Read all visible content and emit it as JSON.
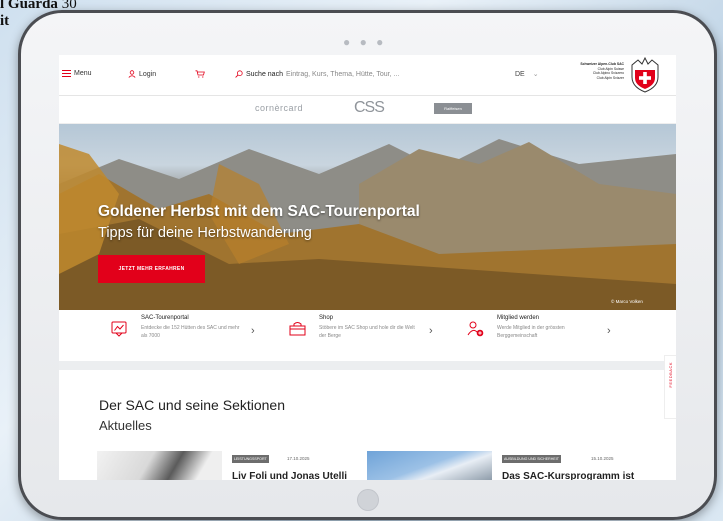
{
  "background": {
    "fragment_title": "l Guarda",
    "fragment_number": "30",
    "fragment_second_line": "it"
  },
  "header": {
    "menu_label": "Menu",
    "login_label": "Login",
    "search_label": "Suche nach",
    "search_placeholder": "Eintrag, Kurs, Thema, Hütte, Tour, ...",
    "language": "DE",
    "club_name": "Schweizer Alpen-Club SAC",
    "club_lines": [
      "Club Alpin Suisse",
      "Club Alpino Svizzero",
      "Club Alpin Svizzer"
    ]
  },
  "sponsors": [
    "cornèrcard",
    "CSS",
    "Raiffeisen"
  ],
  "hero": {
    "title": "Goldener Herbst mit dem SAC-Tourenportal",
    "subtitle": "Tipps für deine Herbstwanderung",
    "button_label": "JETZT MEHR ERFAHREN",
    "credit": "© Marco Volken"
  },
  "quicklinks": [
    {
      "title": "SAC-Tourenportal",
      "desc": "Entdecke die 152 Hütten des SAC und mehr als 7000"
    },
    {
      "title": "Shop",
      "desc": "Stöbere im SAC Shop und hole dir die Welt der Berge"
    },
    {
      "title": "Mitglied werden",
      "desc": "Werde Mitglied in der grössten Berggemeinschaft"
    }
  ],
  "section": {
    "title": "Der SAC und seine Sektionen",
    "subtitle": "Aktuelles"
  },
  "cards": [
    {
      "tag": "LEISTUNGSSPORT",
      "date": "17.10.2025",
      "title": "Liv Foli und Jonas Utelli"
    },
    {
      "tag": "AUSBILDUNG UND SICHERHEIT",
      "date": "15.10.2025",
      "title": "Das SAC-Kursprogramm ist"
    }
  ],
  "feedback_label": "FEEDBACK",
  "colors": {
    "accent": "#e2001a"
  }
}
